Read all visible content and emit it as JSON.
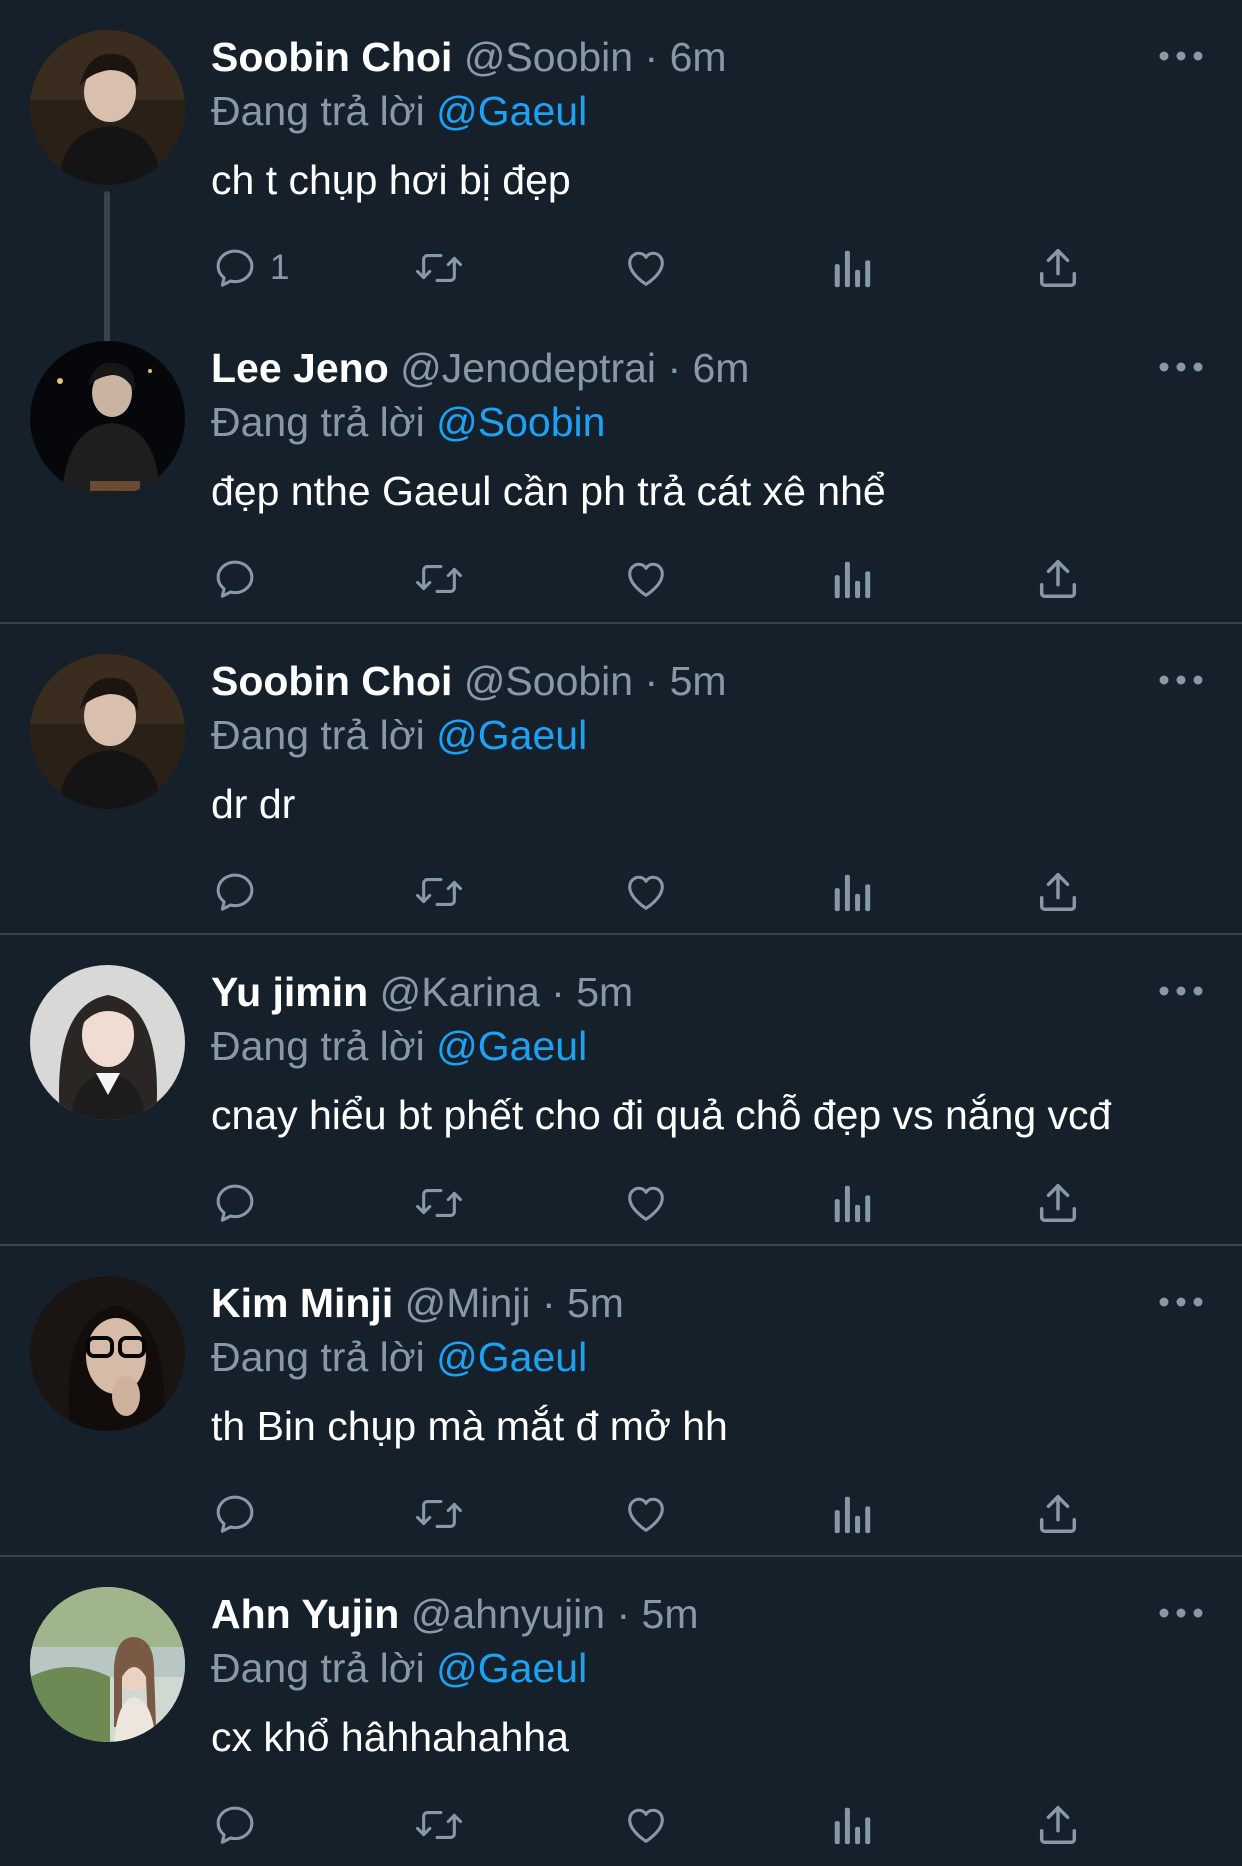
{
  "reply_prefix": "Đang trả lời",
  "tweets": [
    {
      "name": "Soobin Choi",
      "handle": "@Soobin",
      "dot": "·",
      "time": "6m",
      "reply_to": "@Gaeul",
      "text": "ch t chụp hơi bị đẹp",
      "reply_count": "1",
      "avatar_icon": "avatar-dark-portrait"
    },
    {
      "name": "Lee Jeno",
      "handle": "@Jenodeptrai",
      "dot": "·",
      "time": "6m",
      "reply_to": "@Soobin",
      "text": "đẹp nthe Gaeul cần ph trả cát xê nhể",
      "reply_count": "",
      "avatar_icon": "avatar-night-portrait"
    },
    {
      "name": "Soobin Choi",
      "handle": "@Soobin",
      "dot": "·",
      "time": "5m",
      "reply_to": "@Gaeul",
      "text": "dr dr",
      "reply_count": "",
      "avatar_icon": "avatar-dark-portrait"
    },
    {
      "name": "Yu jimin",
      "handle": "@Karina",
      "dot": "·",
      "time": "5m",
      "reply_to": "@Gaeul",
      "text": "cnay hiểu bt phết cho đi quả chỗ đẹp vs nắng vcđ",
      "reply_count": "",
      "avatar_icon": "avatar-light-portrait"
    },
    {
      "name": "Kim Minji",
      "handle": "@Minji",
      "dot": "·",
      "time": "5m",
      "reply_to": "@Gaeul",
      "text": "th Bin chụp mà mắt đ mở hh",
      "reply_count": "",
      "avatar_icon": "avatar-glasses-portrait"
    },
    {
      "name": "Ahn Yujin",
      "handle": "@ahnyujin",
      "dot": "·",
      "time": "5m",
      "reply_to": "@Gaeul",
      "text": "cx khổ hâhhahahha",
      "reply_count": "",
      "avatar_icon": "avatar-outdoor-portrait"
    }
  ],
  "colors": {
    "background": "#15202b",
    "divider": "#38444d",
    "text_primary": "#ffffff",
    "text_secondary": "#8899a6",
    "accent": "#1da1f2"
  },
  "icons": [
    "reply-icon",
    "retweet-icon",
    "like-icon",
    "stats-icon",
    "share-icon",
    "more-icon"
  ]
}
